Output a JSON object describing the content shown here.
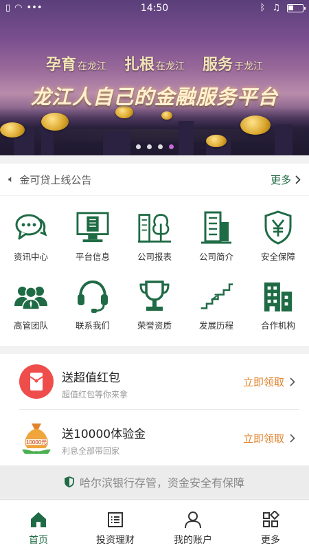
{
  "status_bar": {
    "time": "14:50"
  },
  "banner": {
    "slogans": [
      {
        "big": "孕育",
        "small": "在龙江"
      },
      {
        "big": "扎根",
        "small": "在龙江"
      },
      {
        "big": "服务",
        "small": "于龙江"
      }
    ],
    "title": "龙江人自己的金融服务平台",
    "slides": 4,
    "active_slide": 4
  },
  "notice": {
    "text": "金可贷上线公告",
    "more": "更多"
  },
  "grid": [
    {
      "label": "资讯中心",
      "icon": "chat-bubbles-icon"
    },
    {
      "label": "平台信息",
      "icon": "monitor-icon"
    },
    {
      "label": "公司报表",
      "icon": "building-tree-icon"
    },
    {
      "label": "公司简介",
      "icon": "office-building-icon"
    },
    {
      "label": "安全保障",
      "icon": "yen-shield-icon"
    },
    {
      "label": "高管团队",
      "icon": "team-icon"
    },
    {
      "label": "联系我们",
      "icon": "headset-icon"
    },
    {
      "label": "荣誉资质",
      "icon": "trophy-icon"
    },
    {
      "label": "发展历程",
      "icon": "stairs-icon"
    },
    {
      "label": "合作机构",
      "icon": "buildings-icon"
    }
  ],
  "promos": [
    {
      "title": "送超值红包",
      "subtitle": "超值红包等你来拿",
      "action": "立即领取"
    },
    {
      "title": "送10000体验金",
      "subtitle": "利息全部带回家",
      "action": "立即领取",
      "badge": "10000元"
    }
  ],
  "guarantee": "哈尔滨银行存管，资金安全有保障",
  "tabs": [
    {
      "label": "首页",
      "active": true
    },
    {
      "label": "投资理财",
      "active": false
    },
    {
      "label": "我的账户",
      "active": false
    },
    {
      "label": "更多",
      "active": false
    }
  ],
  "colors": {
    "brand_green": "#1f6b45",
    "accent_orange": "#e0842e",
    "red_packet": "#ef4c4c"
  }
}
